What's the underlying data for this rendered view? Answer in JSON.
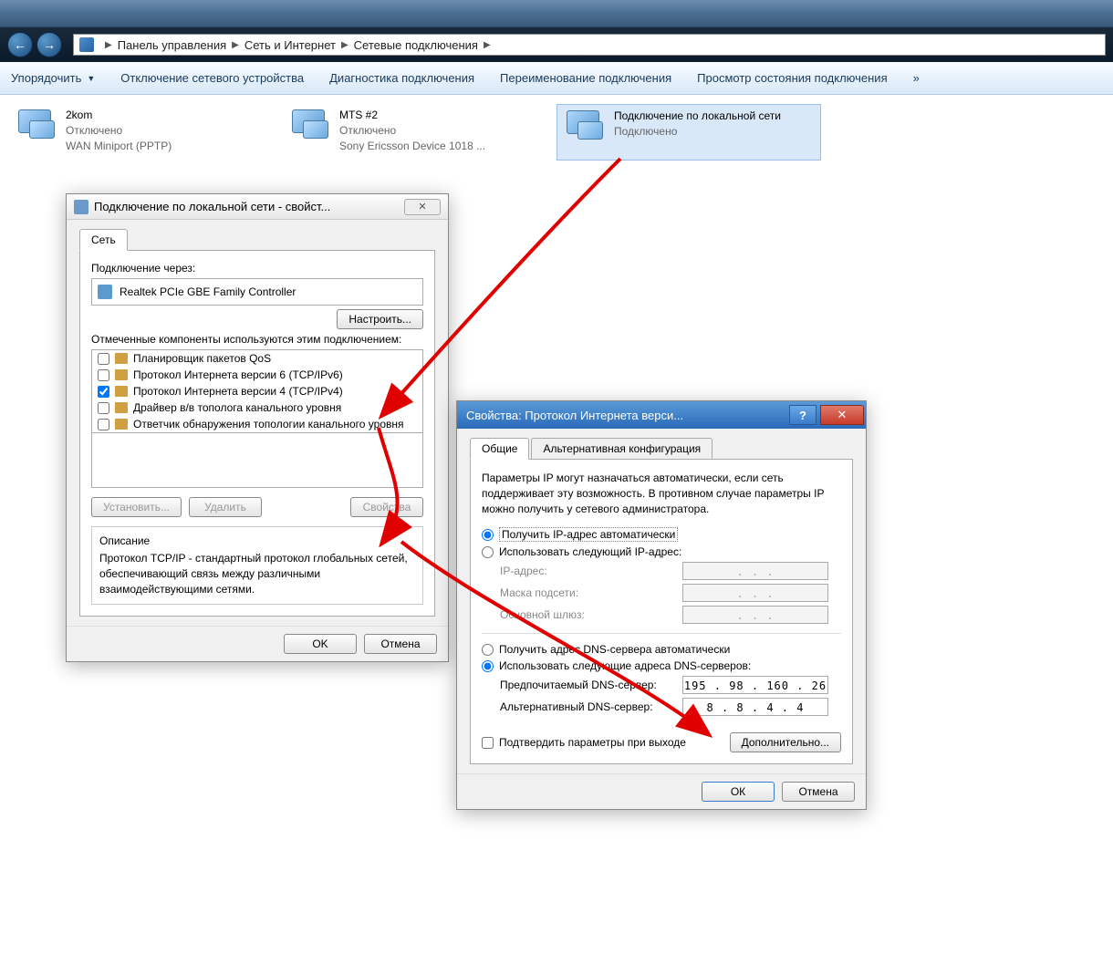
{
  "breadcrumb": {
    "items": [
      "Панель управления",
      "Сеть и Интернет",
      "Сетевые подключения"
    ]
  },
  "toolbar": {
    "organize": "Упорядочить",
    "disable": "Отключение сетевого устройства",
    "diagnose": "Диагностика подключения",
    "rename": "Переименование подключения",
    "view_status": "Просмотр состояния подключения",
    "more": "»"
  },
  "connections": [
    {
      "name": "2kom",
      "status": "Отключено",
      "device": "WAN Miniport (PPTP)"
    },
    {
      "name": "MTS #2",
      "status": "Отключено",
      "device": "Sony Ericsson Device 1018 ..."
    },
    {
      "name": "Подключение по локальной сети",
      "status": "Подключено",
      "device": ""
    }
  ],
  "dlg1": {
    "title": "Подключение по локальной сети - свойст...",
    "tab_network": "Сеть",
    "connect_using": "Подключение через:",
    "adapter": "Realtek PCIe GBE Family Controller",
    "configure": "Настроить...",
    "components_label": "Отмеченные компоненты используются этим подключением:",
    "components": [
      {
        "checked": false,
        "label": "Планировщик пакетов QoS"
      },
      {
        "checked": false,
        "label": "Протокол Интернета версии 6 (TCP/IPv6)"
      },
      {
        "checked": true,
        "label": "Протокол Интернета версии 4 (TCP/IPv4)"
      },
      {
        "checked": false,
        "label": "Драйвер в/в тополога канального уровня"
      },
      {
        "checked": false,
        "label": "Ответчик обнаружения топологии канального уровня"
      }
    ],
    "install": "Установить...",
    "uninstall": "Удалить",
    "properties": "Свойства",
    "description_label": "Описание",
    "description": "Протокол TCP/IP - стандартный протокол глобальных сетей, обеспечивающий связь между различными взаимодействующими сетями.",
    "ok": "OK",
    "cancel": "Отмена"
  },
  "dlg2": {
    "title": "Свойства: Протокол Интернета верси...",
    "tab_general": "Общие",
    "tab_alt": "Альтернативная конфигурация",
    "info": "Параметры IP могут назначаться автоматически, если сеть поддерживает эту возможность. В противном случае параметры IP можно получить у сетевого администратора.",
    "radio_ip_auto": "Получить IP-адрес автоматически",
    "radio_ip_manual": "Использовать следующий IP-адрес:",
    "ip_label": "IP-адрес:",
    "mask_label": "Маска подсети:",
    "gateway_label": "Основной шлюз:",
    "dots": ".       .       .",
    "radio_dns_auto": "Получить адрес DNS-сервера автоматически",
    "radio_dns_manual": "Использовать следующие адреса DNS-серверов:",
    "dns1_label": "Предпочитаемый DNS-сервер:",
    "dns2_label": "Альтернативный DNS-сервер:",
    "dns1": "195 .  98 . 160 .  26",
    "dns2": "8  .  8  .  4  .  4",
    "validate": "Подтвердить параметры при выходе",
    "advanced": "Дополнительно...",
    "ok": "ОК",
    "cancel": "Отмена"
  }
}
